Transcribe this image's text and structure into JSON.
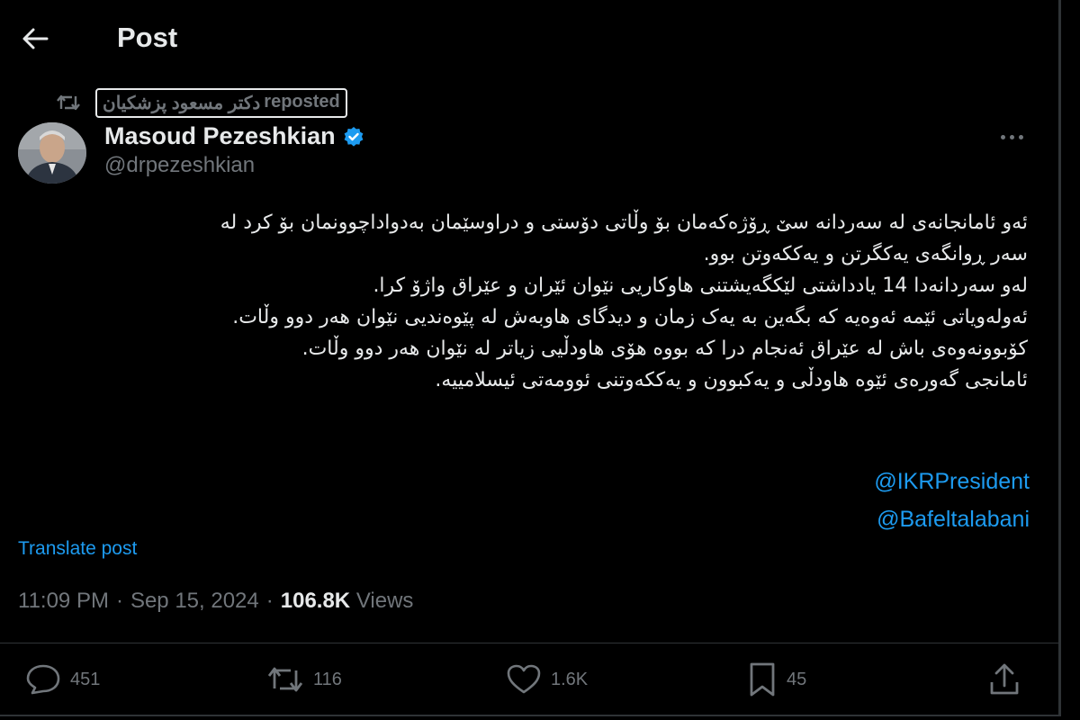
{
  "header": {
    "title": "Post"
  },
  "repost": {
    "name": "دکتر مسعود پزشکیان",
    "label": "reposted"
  },
  "author": {
    "name": "Masoud Pezeshkian",
    "handle": "@drpezeshkian"
  },
  "post": {
    "lines": [
      "ئەو ئامانجانەی لە سەردانە سێ ڕۆژەکەمان بۆ وڵاتی دۆستی و دراوسێمان بەدواداچوونمان بۆ کرد لە",
      "سەر ڕوانگەی یەکگرتن و یەککەوتن بوو.",
      "لەو سەردانەدا 14 یادداشتی لێکگەیشتنی هاوکاریی نێوان ئێران و عێراق واژۆ کرا.",
      "ئەولەویاتی ئێمە ئەوەیە کە بگەین بە یەک زمان و دیدگای هاوبەش لە پێوەندیی نێوان هەر دوو وڵات.",
      "کۆبوونەوەی باش لە عێراق ئەنجام درا کە بووە هۆی هاودڵیی زیاتر لە نێوان هەر دوو وڵات.",
      "ئامانجی گەورەی ئێوە هاودڵی و یەکبوون و یەککەوتنی ئوومەتی ئیسلامییە."
    ],
    "mentions": [
      "@IKRPresident",
      "@Bafeltalabani"
    ]
  },
  "translate_label": "Translate post",
  "meta": {
    "time": "11:09 PM",
    "date": "Sep 15, 2024",
    "views_count": "106.8K",
    "views_label": "Views"
  },
  "actions": {
    "replies": "451",
    "reposts": "116",
    "likes": "1.6K",
    "bookmarks": "45"
  },
  "colors": {
    "background": "#000000",
    "text": "#e7e9ea",
    "muted": "#71767b",
    "accent": "#1d9bf0"
  },
  "icons": {
    "back": "arrow-left-icon",
    "repost_indicator": "repost-icon",
    "verified": "verified-badge-icon",
    "more": "more-icon",
    "reply": "reply-icon",
    "repost": "repost-icon",
    "like": "heart-icon",
    "bookmark": "bookmark-icon",
    "share": "share-icon"
  }
}
